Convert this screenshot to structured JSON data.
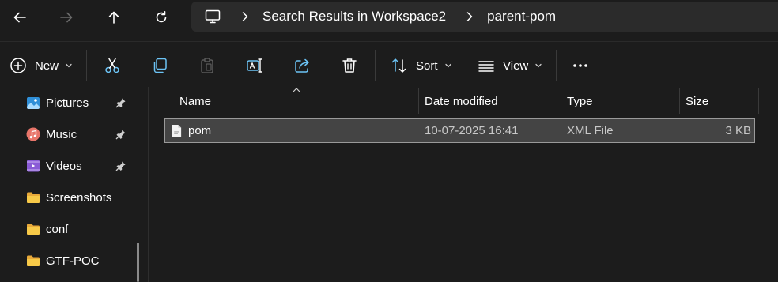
{
  "nav": {
    "back_icon": "arrow-left-icon",
    "forward_icon": "arrow-right-icon",
    "up_icon": "arrow-up-icon",
    "refresh_icon": "refresh-icon"
  },
  "address": {
    "crumbs": [
      "Search Results in Workspace2",
      "parent-pom"
    ]
  },
  "toolbar": {
    "new_label": "New",
    "sort_label": "Sort",
    "view_label": "View"
  },
  "sidebar": {
    "items": [
      {
        "label": "Pictures",
        "icon": "pictures-icon",
        "pinned": true
      },
      {
        "label": "Music",
        "icon": "music-icon",
        "pinned": true
      },
      {
        "label": "Videos",
        "icon": "videos-icon",
        "pinned": true
      },
      {
        "label": "Screenshots",
        "icon": "folder-icon",
        "pinned": false
      },
      {
        "label": "conf",
        "icon": "folder-icon",
        "pinned": false
      },
      {
        "label": "GTF-POC",
        "icon": "folder-icon",
        "pinned": false
      }
    ]
  },
  "list": {
    "columns": [
      "Name",
      "Date modified",
      "Type",
      "Size"
    ],
    "rows": [
      {
        "name": "pom",
        "date": "10-07-2025 16:41",
        "type": "XML File",
        "size": "3 KB",
        "selected": true
      }
    ]
  },
  "colors": {
    "background": "#1c1c1c",
    "address_bg": "#2b2b2b",
    "selection_bg": "#444444",
    "folder_yellow": "#f5c243",
    "accent_blue": "#4cc2ff"
  }
}
